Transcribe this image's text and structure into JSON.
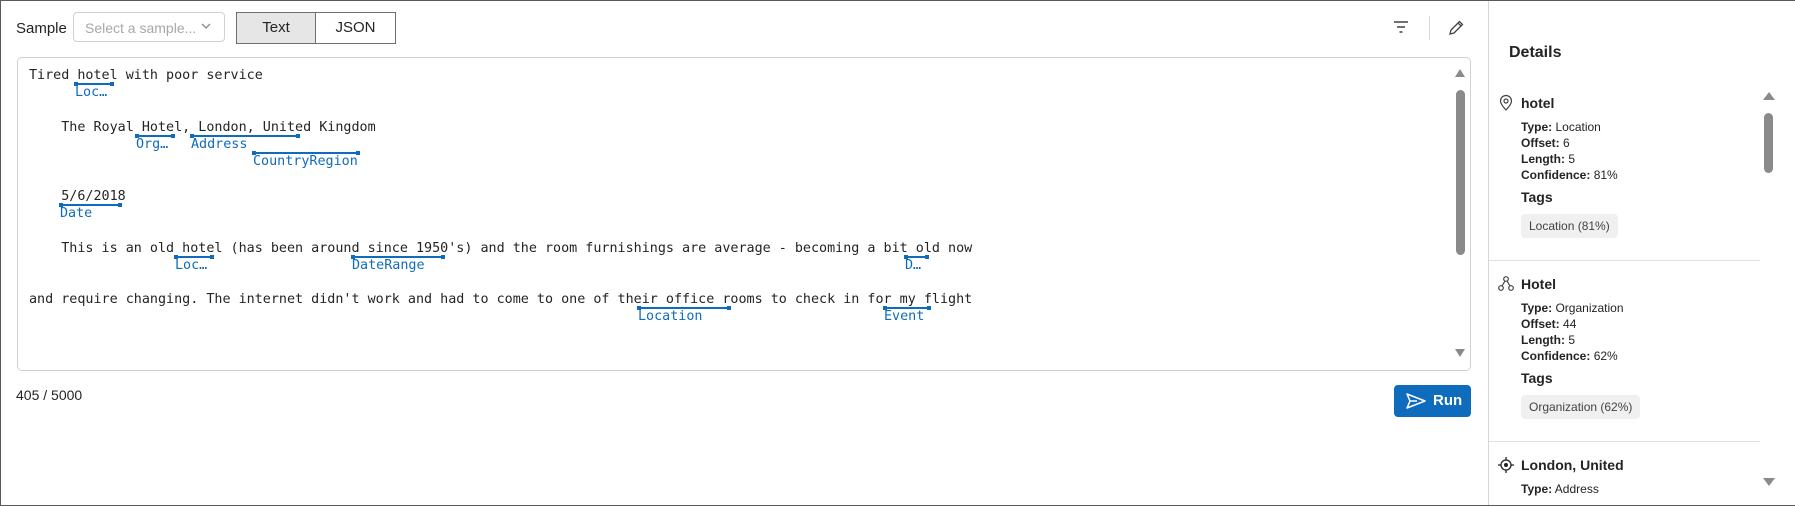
{
  "toolbar": {
    "sample_label": "Sample",
    "sample_placeholder": "Select a sample...",
    "text_tab": "Text",
    "json_tab": "JSON"
  },
  "icons": {
    "filter": "filter-icon",
    "edit": "pencil-icon",
    "run": "send-icon"
  },
  "colors": {
    "accent": "#0f6cbd",
    "selected_tab_bg": "#e6e6e6"
  },
  "editor": {
    "lines": [
      "Tired hotel with poor service",
      "    The Royal Hotel, London, United Kingdom",
      "    5/6/2018",
      "    This is an old hotel (has been around since 1950's) and the room furnishings are average - becoming a bit old now",
      "and require changing. The internet didn't work and had to come to one of their office rooms to check in for my flight"
    ],
    "entity_labels": [
      "Loc…",
      "Org…",
      "Address",
      "CountryRegion",
      "Date",
      "Loc…",
      "DateRange",
      "D…",
      "Location",
      "Event"
    ]
  },
  "footer": {
    "char_count": "405 / 5000",
    "run_label": "Run"
  },
  "details": {
    "title": "Details",
    "entities": [
      {
        "name": "hotel",
        "icon": "location-pin-icon",
        "type": "Location",
        "offset": "6",
        "length": "5",
        "confidence": "81%",
        "tags_title": "Tags",
        "tags": [
          "Location (81%)"
        ]
      },
      {
        "name": "Hotel",
        "icon": "organization-icon",
        "type": "Organization",
        "offset": "44",
        "length": "5",
        "confidence": "62%",
        "tags_title": "Tags",
        "tags": [
          "Organization (62%)"
        ]
      },
      {
        "name": "London, United",
        "icon": "address-target-icon",
        "type": "Address"
      }
    ],
    "labels": {
      "type": "Type:",
      "offset": "Offset:",
      "length": "Length:",
      "confidence": "Confidence:"
    }
  }
}
